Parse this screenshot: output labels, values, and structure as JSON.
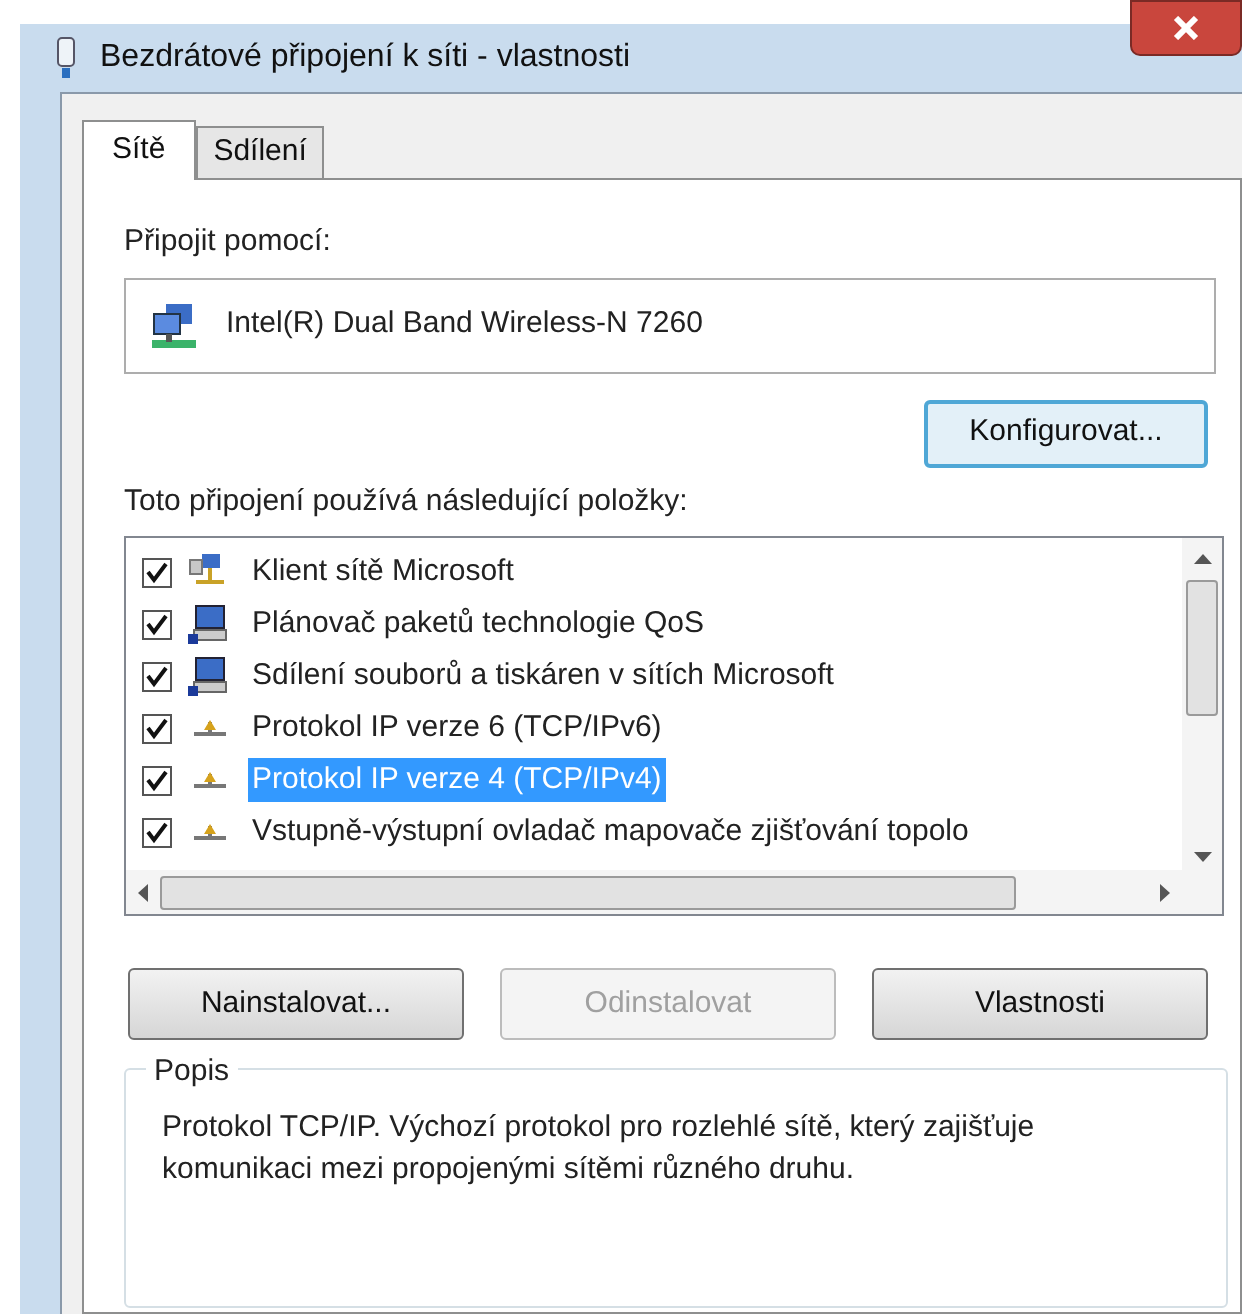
{
  "window": {
    "title": "Bezdrátové připojení k síti - vlastnosti"
  },
  "tabs": [
    {
      "label": "Sítě",
      "selected": true
    },
    {
      "label": "Sdílení",
      "selected": false
    }
  ],
  "connect_using": {
    "label": "Připojit pomocí:",
    "adapter": "Intel(R) Dual Band Wireless-N 7260",
    "button": "Konfigurovat..."
  },
  "items_label": "Toto připojení používá následující položky:",
  "items": [
    {
      "label": "Klient sítě Microsoft",
      "checked": true,
      "selected": false,
      "kind": "client"
    },
    {
      "label": "Plánovač paketů technologie QoS",
      "checked": true,
      "selected": false,
      "kind": "service"
    },
    {
      "label": "Sdílení souborů a tiskáren v sítích Microsoft",
      "checked": true,
      "selected": false,
      "kind": "service"
    },
    {
      "label": "Protokol IP verze 6 (TCP/IPv6)",
      "checked": true,
      "selected": false,
      "kind": "protocol"
    },
    {
      "label": "Protokol IP verze 4 (TCP/IPv4)",
      "checked": true,
      "selected": true,
      "kind": "protocol"
    },
    {
      "label": "Vstupně-výstupní ovladač mapovače zjišťování topolo",
      "checked": true,
      "selected": false,
      "kind": "protocol"
    }
  ],
  "buttons": [
    {
      "label": "Nainstalovat...",
      "disabled": false
    },
    {
      "label": "Odinstalovat",
      "disabled": true
    },
    {
      "label": "Vlastnosti",
      "disabled": false
    }
  ],
  "description": {
    "title": "Popis",
    "text": "Protokol TCP/IP. Výchozí protokol pro rozlehlé sítě, který zajišťuje komunikaci mezi propojenými sítěmi různého druhu."
  }
}
